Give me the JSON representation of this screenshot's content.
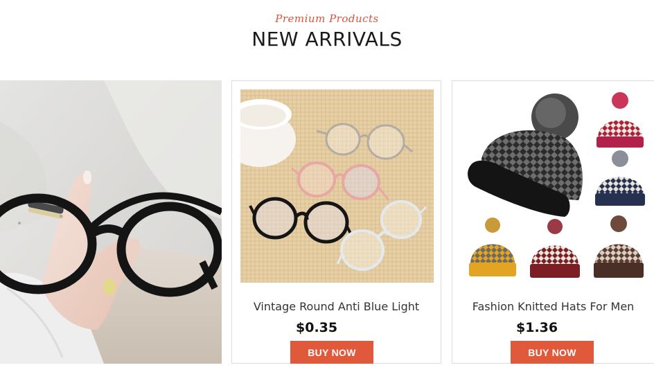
{
  "header": {
    "subtitle": "Premium Products",
    "title": "NEW ARRIVALS"
  },
  "products": [
    {
      "name": "Vintage Round Anti Blue Light",
      "price": "$0.35",
      "button": "BUY NOW"
    },
    {
      "name": "Fashion Knitted Hats For Men",
      "price": "$1.36",
      "button": "BUY NOW"
    }
  ],
  "colors": {
    "accent": "#e0593b",
    "subtitle": "#e0513a",
    "title": "#1a1a1a"
  },
  "icons": [
    "round-glasses-photo",
    "glasses-on-burlap-photo",
    "knitted-hats-photo"
  ]
}
